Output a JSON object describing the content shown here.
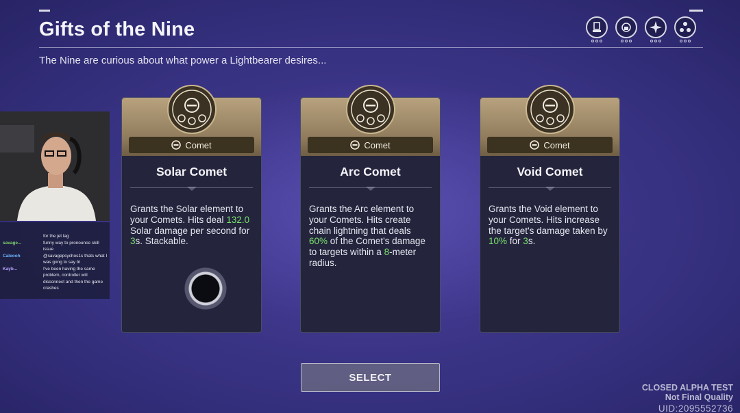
{
  "header": {
    "title": "Gifts of the Nine",
    "subtitle": "The Nine are curious about what power a Lightbearer desires..."
  },
  "top_icons": [
    {
      "icon": "card-slot-icon"
    },
    {
      "icon": "lock-ring-icon"
    },
    {
      "icon": "compass-star-icon"
    },
    {
      "icon": "triad-orb-icon"
    }
  ],
  "cards": [
    {
      "tag": "Comet",
      "name": "Solar Comet",
      "desc_parts": [
        {
          "t": "Grants the Solar element to your Comets. Hits deal "
        },
        {
          "t": "132.0",
          "hl": true
        },
        {
          "t": " Solar damage per second for "
        },
        {
          "t": "3",
          "hl": true
        },
        {
          "t": "s. Stackable."
        }
      ]
    },
    {
      "tag": "Comet",
      "name": "Arc Comet",
      "desc_parts": [
        {
          "t": "Grants the Arc element to your Comets. Hits create chain lightning that deals "
        },
        {
          "t": "60%",
          "hl": true
        },
        {
          "t": " of the Comet's damage to targets within a "
        },
        {
          "t": "8",
          "hl": true
        },
        {
          "t": "-meter radius."
        }
      ]
    },
    {
      "tag": "Comet",
      "name": "Void Comet",
      "desc_parts": [
        {
          "t": "Grants the Void element to your Comets. Hits increase the target's damage taken by "
        },
        {
          "t": "10%",
          "hl": true
        },
        {
          "t": " for "
        },
        {
          "t": "3",
          "hl": true
        },
        {
          "t": "s."
        }
      ]
    }
  ],
  "select_label": "SELECT",
  "chat": [
    {
      "user": "",
      "msg": "for the jet lag"
    },
    {
      "user": "savage...",
      "msg": "funny way to pronounce skill issue"
    },
    {
      "user": "Caleooh",
      "msg": "@savagepsychos1s thats what I was gong to say bl"
    },
    {
      "user": "Kayb...",
      "msg": "I've been having the same problem, controller will disconnect and then the game crashes"
    }
  ],
  "watermark": {
    "line1": "CLOSED ALPHA TEST",
    "line2": "Not Final Quality",
    "uid": "UID:2095552736"
  },
  "colors": {
    "highlight": "#7be36b",
    "card_bg": "#24253d",
    "card_head": "#b8a27e"
  }
}
